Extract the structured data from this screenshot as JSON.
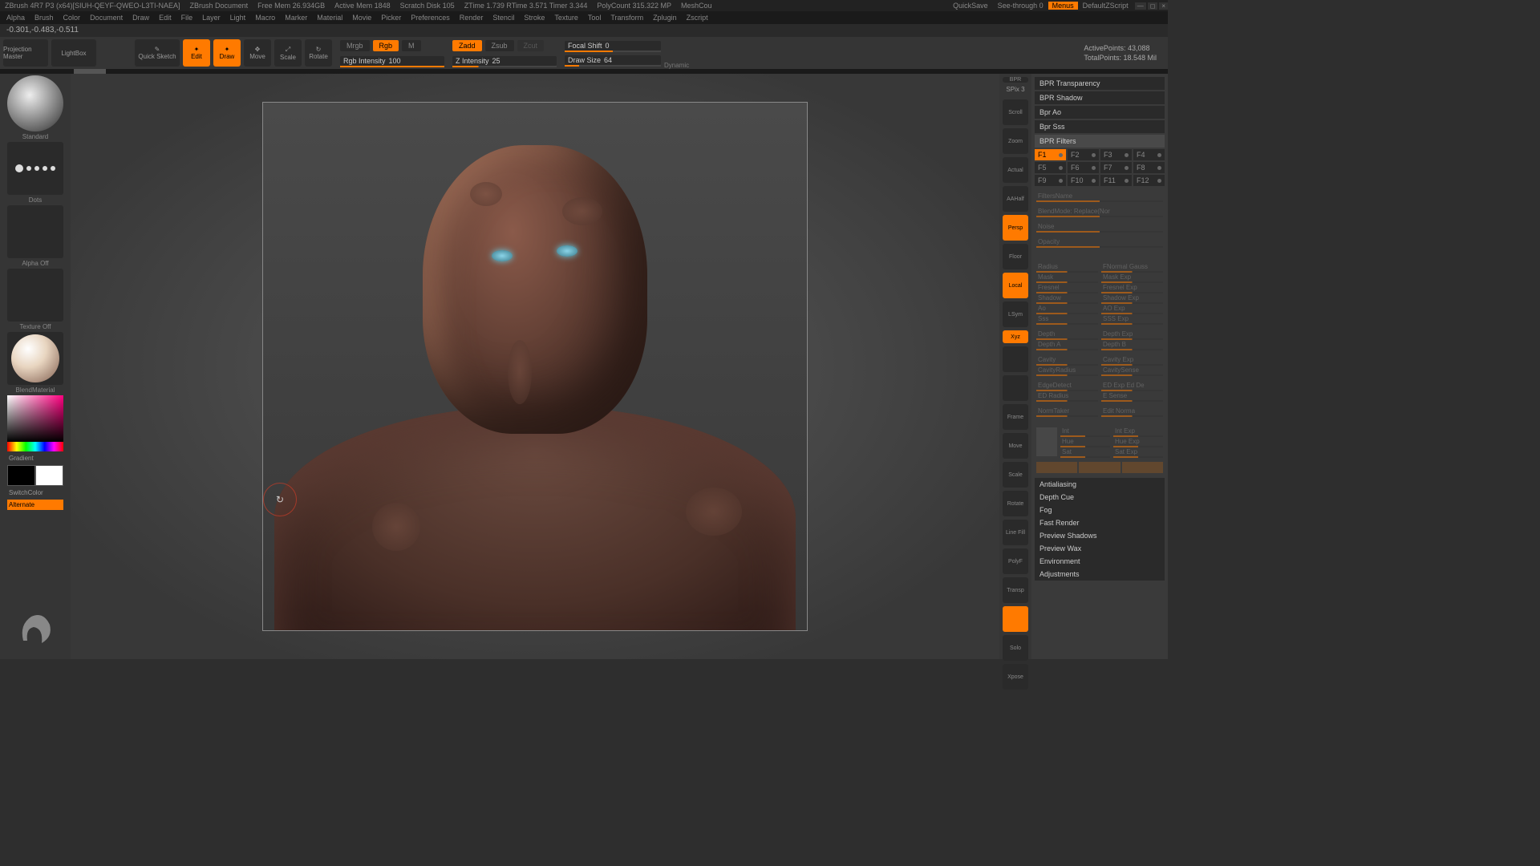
{
  "titlebar": {
    "app": "ZBrush 4R7 P3 (x64)[SIUH-QEYF-QWEO-L3TI-NAEA]",
    "doc": "ZBrush Document",
    "stats": [
      "Free Mem 26.934GB",
      "Active Mem 1848",
      "Scratch Disk 105",
      "ZTime 1.739 RTime 3.571 Timer 3.344",
      "PolyCount 315.322 MP",
      "MeshCou"
    ],
    "quicksave": "QuickSave",
    "seethrough": "See-through 0",
    "menus": "Menus",
    "script": "DefaultZScript"
  },
  "menubar": [
    "Alpha",
    "Brush",
    "Color",
    "Document",
    "Draw",
    "Edit",
    "File",
    "Layer",
    "Light",
    "Macro",
    "Marker",
    "Material",
    "Movie",
    "Picker",
    "Preferences",
    "Render",
    "Stencil",
    "Stroke",
    "Texture",
    "Tool",
    "Transform",
    "Zplugin",
    "Zscript"
  ],
  "coords": "-0.301,-0.483,-0.511",
  "toolbar": {
    "projection": "Projection\nMaster",
    "lightbox": "LightBox",
    "quicksketch": "Quick\nSketch",
    "edit": "Edit",
    "draw": "Draw",
    "move": "Move",
    "scale": "Scale",
    "rotate": "Rotate",
    "mrgb": "Mrgb",
    "rgb": "Rgb",
    "m": "M",
    "rgbintensity_label": "Rgb Intensity",
    "rgbintensity_val": "100",
    "zadd": "Zadd",
    "zsub": "Zsub",
    "zcut": "Zcut",
    "zintensity_label": "Z Intensity",
    "zintensity_val": "25",
    "focalshift_label": "Focal Shift",
    "focalshift_val": "0",
    "drawsize_label": "Draw Size",
    "drawsize_val": "64",
    "dynamic": "Dynamic",
    "activepoints_label": "ActivePoints:",
    "activepoints_val": "43,088",
    "totalpoints_label": "TotalPoints:",
    "totalpoints_val": "18.548 Mil"
  },
  "leftpanel": {
    "brush": "Standard",
    "stroke": "Dots",
    "alpha": "Alpha Off",
    "texture": "Texture Off",
    "material": "BlendMaterial",
    "gradient": "Gradient",
    "switchcolor": "SwitchColor",
    "alternate": "Alternate"
  },
  "rsidebar": {
    "bpr": "BPR",
    "spix_label": "SPix",
    "spix_val": "3",
    "items": [
      "Scroll",
      "Zoom",
      "Actual",
      "AAHalf",
      "Persp",
      "Floor",
      "Local",
      "LSym",
      "Xyz",
      "",
      "",
      "Frame",
      "Move",
      "Scale",
      "Rotate",
      "Line Fill",
      "PolyF",
      "Transp",
      "",
      "Solo",
      "Xpose"
    ]
  },
  "rightpanel": {
    "sections": [
      "BPR Transparency",
      "BPR Shadow",
      "Bpr Ao",
      "Bpr Sss"
    ],
    "filters_header": "BPR Filters",
    "filters": [
      "F1",
      "F2",
      "F3",
      "F4",
      "F5",
      "F6",
      "F7",
      "F8",
      "F9",
      "F10",
      "F11",
      "F12"
    ],
    "filtersname": "FiltersName",
    "blendmode": "BlendMode: Replace(Nor",
    "noise": "Noise",
    "opacity": "Opacity",
    "slider_rows": [
      [
        "Radius",
        "FNormal Gauss"
      ],
      [
        "Mask",
        "Mask Exp"
      ],
      [
        "Fresnel",
        "Fresnel Exp"
      ],
      [
        "Shadow",
        "Shadow Exp"
      ],
      [
        "Ao",
        "AO Exp"
      ],
      [
        "Sss",
        "SSS Exp"
      ],
      [
        "Depth",
        "Depth Exp"
      ],
      [
        "Depth A",
        "Depth B"
      ],
      [
        "Cavity",
        "Cavity Exp"
      ],
      [
        "CavityRadius",
        "CavitySense"
      ],
      [
        "EdgeDetect",
        "ED Exp  Ed De"
      ],
      [
        "ED Radius",
        "E Sense"
      ],
      [
        "NormTaker",
        "Edit Norma"
      ],
      [
        "Int",
        "Int Exp"
      ],
      [
        "Hue",
        "Hue Exp"
      ],
      [
        "Sat",
        "Sat Exp"
      ]
    ],
    "bottom": [
      "Antialiasing",
      "Depth Cue",
      "Fog",
      "Fast Render",
      "Preview Shadows",
      "Preview Wax",
      "Environment",
      "Adjustments"
    ]
  }
}
